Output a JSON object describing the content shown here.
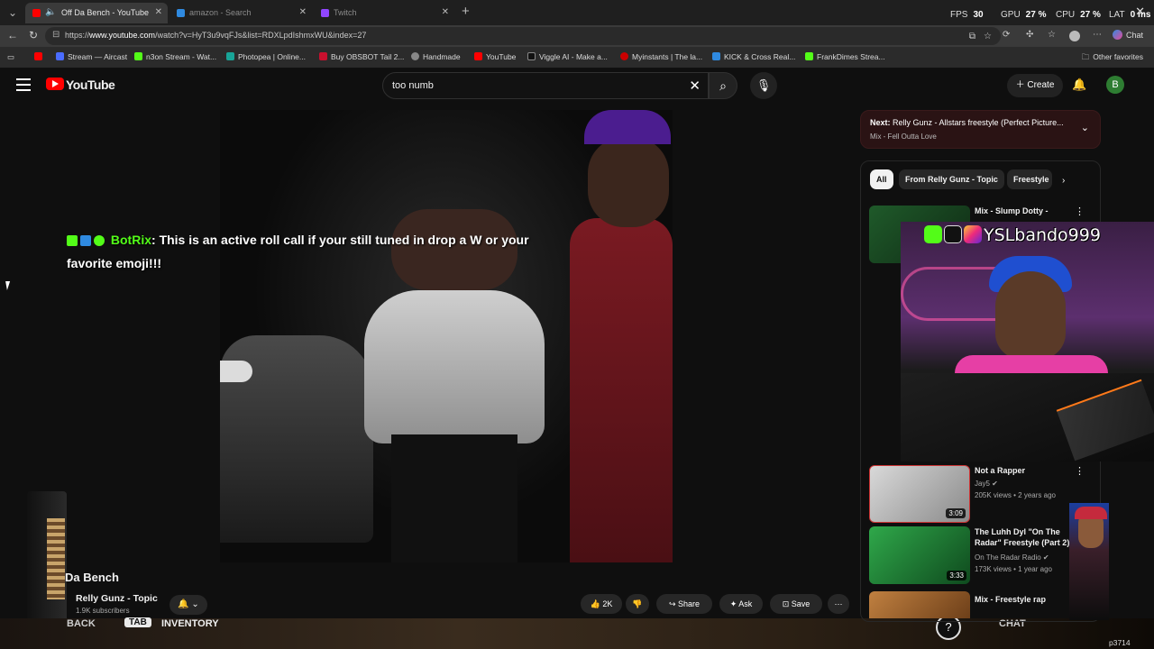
{
  "browser": {
    "tabs": [
      {
        "title": "Off Da Bench - YouTube",
        "active": true,
        "favicon_color": "#ff0000"
      },
      {
        "title": "amazon - Search",
        "active": false,
        "favicon_color": "#2f8ae0"
      },
      {
        "title": "Twitch",
        "active": false,
        "favicon_color": "#9146ff"
      }
    ],
    "perf": {
      "fps_label": "FPS",
      "fps": "30",
      "gpu_label": "GPU",
      "gpu": "27 %",
      "cpu_label": "CPU",
      "cpu": "27 %",
      "lat_label": "LAT",
      "lat": "0 ms"
    },
    "url_prefix": "https://",
    "url_domain": "www.youtube.com",
    "url_path": "/watch?v=HyT3u9vqFJs&list=RDXLpdIshmxWU&index=27",
    "chat_label": "Chat",
    "bookmarks": [
      {
        "label": "",
        "color": "#ff0000"
      },
      {
        "label": "Stream — Aircast",
        "color": "#4a6cff"
      },
      {
        "label": "n3on Stream - Wat...",
        "color": "#53fc18"
      },
      {
        "label": "Photopea | Online...",
        "color": "#18a497"
      },
      {
        "label": "Buy OBSBOT Tail 2...",
        "color": "#c8102e"
      },
      {
        "label": "Handmade",
        "color": "#888888"
      },
      {
        "label": "YouTube",
        "color": "#ff0000"
      },
      {
        "label": "Viggle AI - Make a...",
        "color": "#111111"
      },
      {
        "label": "Myinstants | The la...",
        "color": "#cc0000"
      },
      {
        "label": "KICK & Cross Real...",
        "color": "#2f8ae0"
      },
      {
        "label": "FrankDimes Strea...",
        "color": "#53fc18"
      }
    ],
    "other_favorites": "Other favorites"
  },
  "youtube": {
    "logo_text": "YouTube",
    "search_value": "too numb",
    "create_label": "Create",
    "avatar_letter": "B",
    "video": {
      "title": "Da Bench",
      "channel": "Relly Gunz - Topic",
      "subscribers": "1.9K subscribers",
      "likes": "2K",
      "share": "Share",
      "ask": "Ask",
      "save": "Save"
    },
    "next": {
      "prefix": "Next:",
      "title": "Relly Gunz - Allstars freestyle (Perfect Picture...",
      "subtitle": "Mix - Fell Outta Love"
    },
    "chips": [
      "All",
      "From Relly Gunz - Topic",
      "Freestyle"
    ],
    "related": [
      {
        "title": "Mix - Slump Dotty -",
        "channel": "",
        "meta": "",
        "duration": "",
        "thumb_color": "#1f5a2a"
      },
      {
        "title": "Not a Rapper",
        "channel": "Jay5",
        "meta": "205K views • 2 years ago",
        "duration": "3:09",
        "thumb_color": "#b9b9b9"
      },
      {
        "title": "The Luhh Dyl \"On The Radar\" Freestyle (Part 2)",
        "channel": "On The Radar Radio",
        "meta": "173K views • 1 year ago",
        "duration": "3:33",
        "thumb_color": "#2fa84a"
      },
      {
        "title": "Mix - Freestyle rap",
        "channel": "",
        "meta": "",
        "duration": "",
        "thumb_color": "#a86a2a"
      }
    ]
  },
  "overlays": {
    "botrix_name": "BotRix",
    "botrix_message": ": This is an active roll call if your still tuned in drop a W or your favorite emoji!!!",
    "streamer_name": "YSLbando999",
    "game_back": "BACK",
    "game_tab": "TAB",
    "game_inventory": "INVENTORY",
    "game_help": "?",
    "game_chat": "CHAT",
    "game_code": "p3714"
  }
}
